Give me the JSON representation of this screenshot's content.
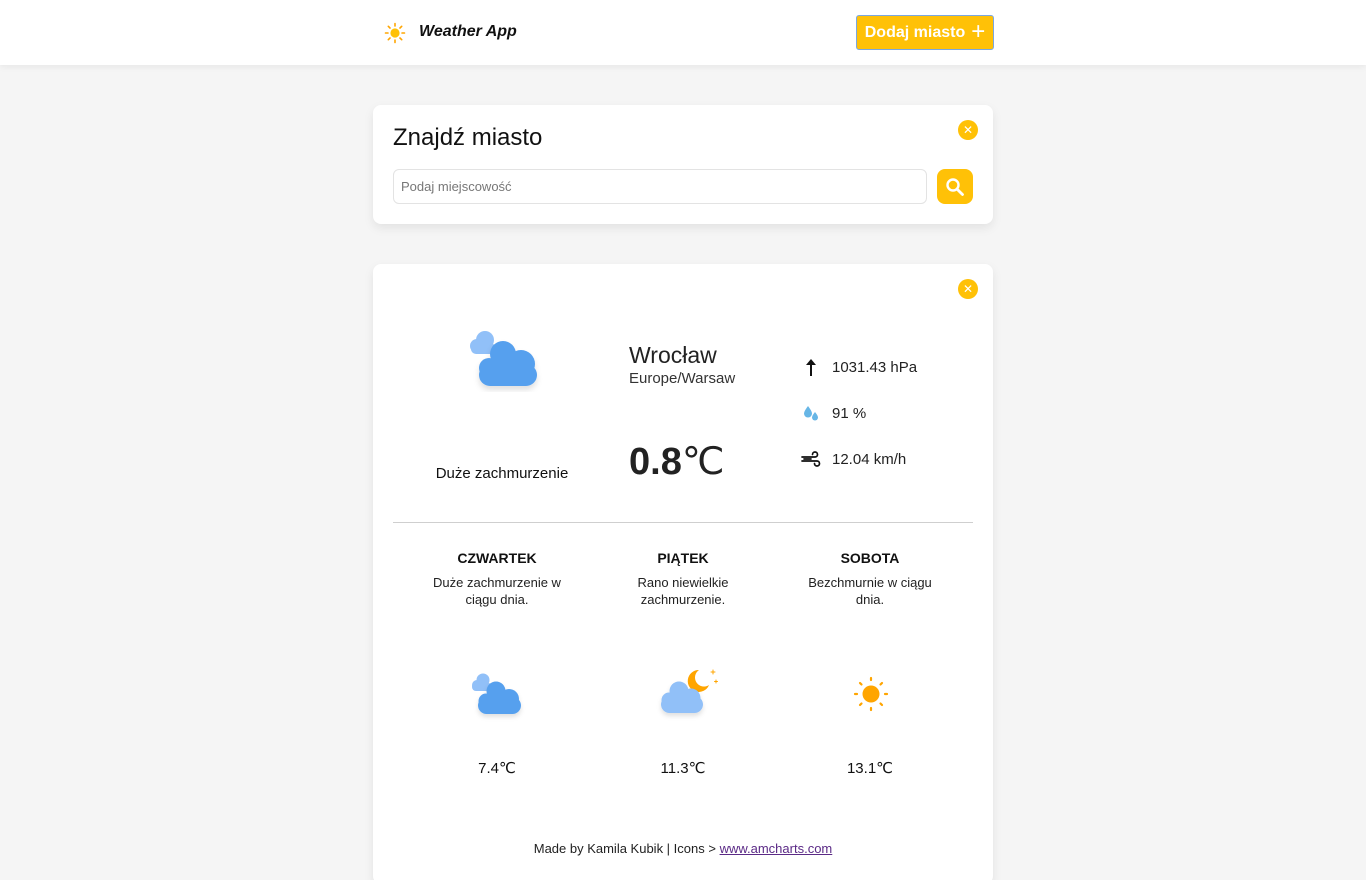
{
  "header": {
    "logo_icon": "sun-icon",
    "app_title": "Weather App",
    "add_city_label": "Dodaj miasto",
    "add_city_icon": "plus-icon"
  },
  "search": {
    "title": "Znajdź miasto",
    "placeholder": "Podaj miejscowość",
    "value": "",
    "close_icon": "close-icon",
    "search_icon": "search-icon"
  },
  "current": {
    "icon": "cloudy-icon",
    "description": "Duże zachmurzenie",
    "city": "Wrocław",
    "timezone": "Europe/Warsaw",
    "temperature": "0.8",
    "unit": "℃",
    "stats": {
      "pressure": "1031.43 hPa",
      "humidity": "91 %",
      "wind": "12.04 km/h"
    }
  },
  "forecast": [
    {
      "day": "CZWARTEK",
      "description": "Duże zachmurzenie w ciągu dnia.",
      "temp": "7.4℃",
      "icon": "cloudy-icon"
    },
    {
      "day": "PIĄTEK",
      "description": "Rano niewielkie zachmurzenie.",
      "temp": "11.3℃",
      "icon": "cloudy-night-icon"
    },
    {
      "day": "SOBOTA",
      "description": "Bezchmurnie w ciągu dnia.",
      "temp": "13.1℃",
      "icon": "sun-icon"
    }
  ],
  "footer": {
    "text": "Made by Kamila Kubik | Icons > ",
    "link": "www.amcharts.com"
  },
  "colors": {
    "accent": "#ffc107",
    "cloud_blue": "#57a0ee",
    "cloud_light": "#91c0f8",
    "sun_orange": "#ffa500"
  }
}
